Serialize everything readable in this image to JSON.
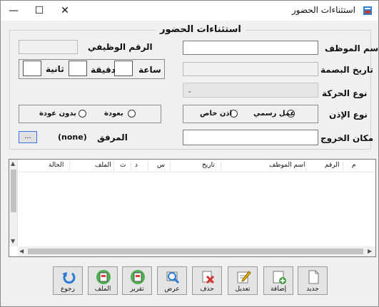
{
  "window": {
    "title": "استثناءات الحضور"
  },
  "titlebar_controls": {
    "minimize": "—",
    "maximize": "☐",
    "close": "✕"
  },
  "group": {
    "legend": "استثناءات الحضور"
  },
  "form": {
    "employee_name_label": "اسم الموظف",
    "employee_id_label": "الرقم الوظيفي",
    "fingerprint_date_label": "تاريخ البصمة",
    "hour_label": "ساعة",
    "minute_label": "دقيقة",
    "second_label": "ثانية",
    "movement_type_label": "نوع الحركة",
    "permission_type_label": "نوع الإذن",
    "official_work_label": "عمل رسمي",
    "private_leave_label": "اذن خاص",
    "with_return_label": "بعودة",
    "without_return_label": "بدون عودة",
    "exit_place_label": "مكان الخروج",
    "attachment_label": "المرفق",
    "attachment_value": "(none)",
    "browse_label": "..."
  },
  "listview": {
    "columns": [
      "م",
      "الرقم",
      "اسم الموظف",
      "تاريخ",
      "س",
      "د",
      "ث",
      "الملف",
      "الحالة"
    ]
  },
  "toolbar": {
    "new": "جديد",
    "add": "إضافة",
    "edit": "تعديل",
    "delete": "حذف",
    "view": "عرض",
    "report": "تقرير",
    "file": "الملف",
    "back": "رجوع"
  }
}
